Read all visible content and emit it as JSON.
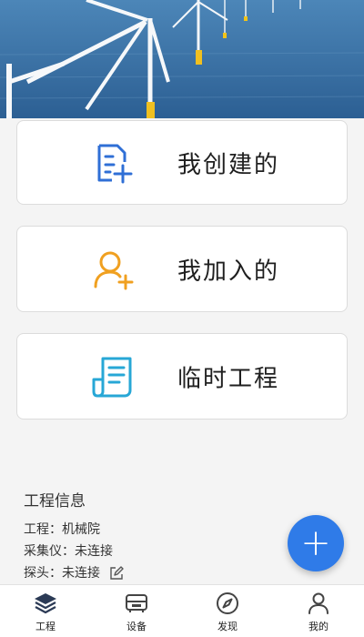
{
  "cards": {
    "created": {
      "label": "我创建的",
      "icon": "file-add-icon",
      "color": "#2f6fd6"
    },
    "joined": {
      "label": "我加入的",
      "icon": "user-add-icon",
      "color": "#f0a020"
    },
    "temporary": {
      "label": "临时工程",
      "icon": "document-scroll-icon",
      "color": "#27a7d6"
    }
  },
  "info": {
    "title": "工程信息",
    "project": "工程：机械院",
    "collector": "采集仪：未连接",
    "probe": "探头：未连接"
  },
  "fab": {
    "label": "+"
  },
  "nav": {
    "tabs": [
      {
        "label": "工程",
        "icon": "layers-icon",
        "active": true
      },
      {
        "label": "设备",
        "icon": "device-icon",
        "active": false
      },
      {
        "label": "发现",
        "icon": "compass-icon",
        "active": false
      },
      {
        "label": "我的",
        "icon": "person-icon",
        "active": false
      }
    ]
  }
}
